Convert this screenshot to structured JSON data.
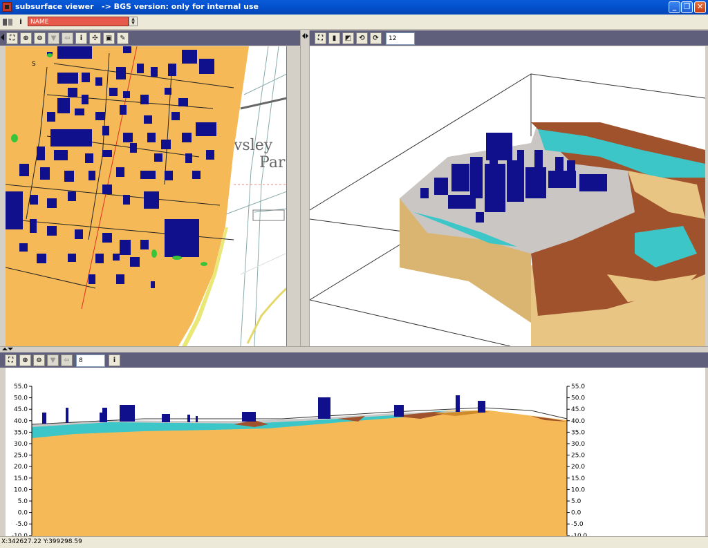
{
  "window": {
    "title": "subsurface viewer   -> BGS version: only for internal use",
    "minimize": "_",
    "maximize": "❐",
    "close": "✕"
  },
  "toolbar": {
    "info_label": "i",
    "name_field_value": "NAME"
  },
  "map_panel": {
    "tools": [
      "zoom-extent",
      "zoom-in",
      "zoom-out",
      "pan",
      "back",
      "info",
      "add-section",
      "layers",
      "legend"
    ],
    "text_fragments": [
      "S",
      "vsley",
      "Par"
    ]
  },
  "view3d_panel": {
    "zoom_value": "12"
  },
  "section_panel": {
    "zoom_value": "8",
    "info_label": "i",
    "y_ticks": [
      "55.0",
      "50.0",
      "45.0",
      "40.0",
      "35.0",
      "30.0",
      "25.0",
      "20.0",
      "15.0",
      "10.0",
      "5.0",
      "0.0",
      "-5.0",
      "-10.0"
    ]
  },
  "status": {
    "coordinates": "X:342627.22 Y:399298.59"
  },
  "colors": {
    "titlebar": "#0552cf",
    "panel_toolbar": "#5f5f7c",
    "bedrock": "#f5b957",
    "buildings": "#10108c",
    "clay": "#a0522d",
    "water": "#3cc6c8",
    "made_ground": "#c8c8c8"
  }
}
